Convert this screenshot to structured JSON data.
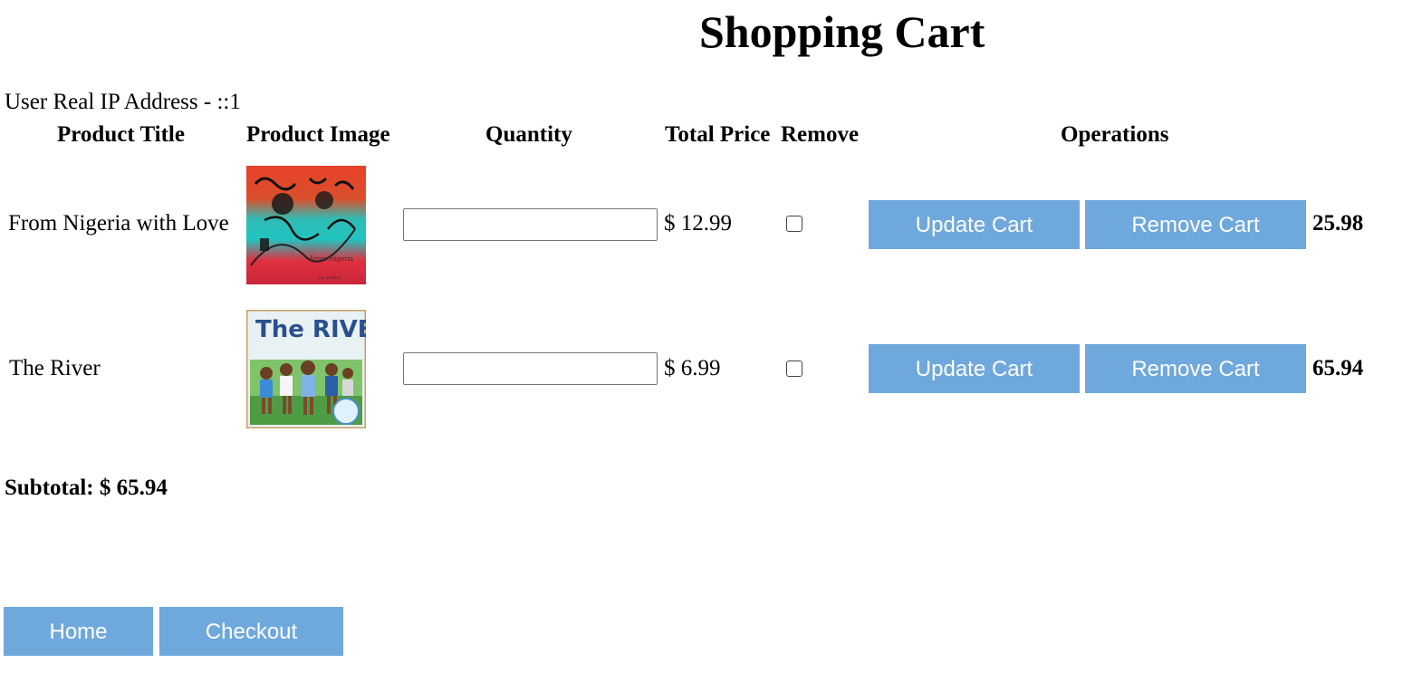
{
  "page": {
    "title": "Shopping Cart"
  },
  "ip_line": "User Real IP Address - ::1",
  "headers": {
    "product_title": "Product Title",
    "product_image": "Product Image",
    "quantity": "Quantity",
    "total_price": "Total Price",
    "remove": "Remove",
    "operations": "Operations"
  },
  "items": [
    {
      "title": "From Nigeria with Love",
      "image_icon": "book-cover-image",
      "quantity": "",
      "price": "$ 12.99",
      "remove_checked": false,
      "update_label": "Update Cart",
      "remove_label": "Remove Cart",
      "row_total": "25.98"
    },
    {
      "title": "The River",
      "image_icon": "book-cover-image",
      "cover_title": "The RIVER",
      "quantity": "",
      "price": "$ 6.99",
      "remove_checked": false,
      "update_label": "Update Cart",
      "remove_label": "Remove Cart",
      "row_total": "65.94"
    }
  ],
  "subtotal": "Subtotal: $ 65.94",
  "footer": {
    "home_label": "Home",
    "checkout_label": "Checkout"
  },
  "colors": {
    "button": "#6fa8dc",
    "button_text": "#ffffff"
  }
}
